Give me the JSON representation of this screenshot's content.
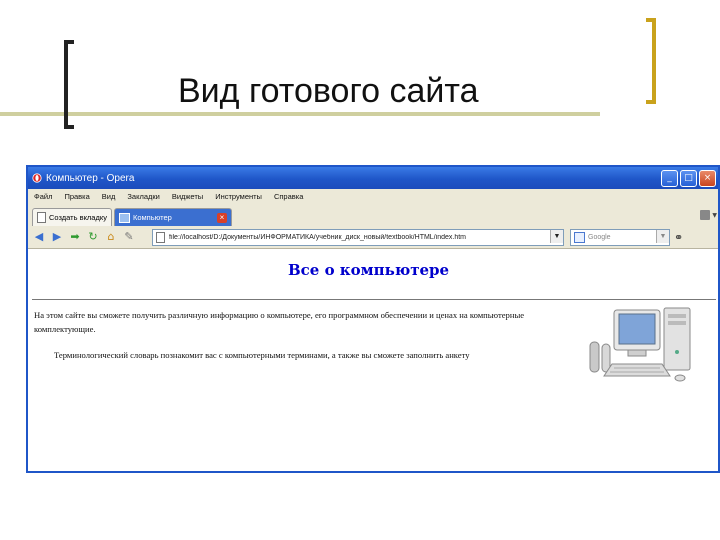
{
  "slide": {
    "title": "Вид готового сайта"
  },
  "browser": {
    "window_title": "Компьютер - Opera",
    "controls": {
      "minimize": "_",
      "maximize": "□",
      "close": "×"
    },
    "menu": [
      "Файл",
      "Правка",
      "Вид",
      "Закладки",
      "Виджеты",
      "Инструменты",
      "Справка"
    ],
    "tabs": [
      {
        "label": "Создать вкладку",
        "active": false
      },
      {
        "label": "Компьютер",
        "active": true
      }
    ],
    "address": "file://localhost/D:/Документы/ИНФОРМАТИКА/учебник_диск_новый/textbook/HTML/index.htm",
    "search_placeholder": "Google"
  },
  "page": {
    "heading": "Все о компьютере",
    "paragraph1": "На этом сайте вы сможете получить различную информацию о компьютере, его программном обеспечении и ценах на компьютерные комплектующие.",
    "paragraph2": "Терминологический словарь познакомит вас с компьютерными терминами, а также вы сможете заполнить анкету"
  },
  "colors": {
    "titlebar": "#1f56c8",
    "heading": "#0000cc",
    "bracket_left": "#222222",
    "bracket_right": "#c9a21c",
    "deco_line": "#cfcf9f"
  }
}
